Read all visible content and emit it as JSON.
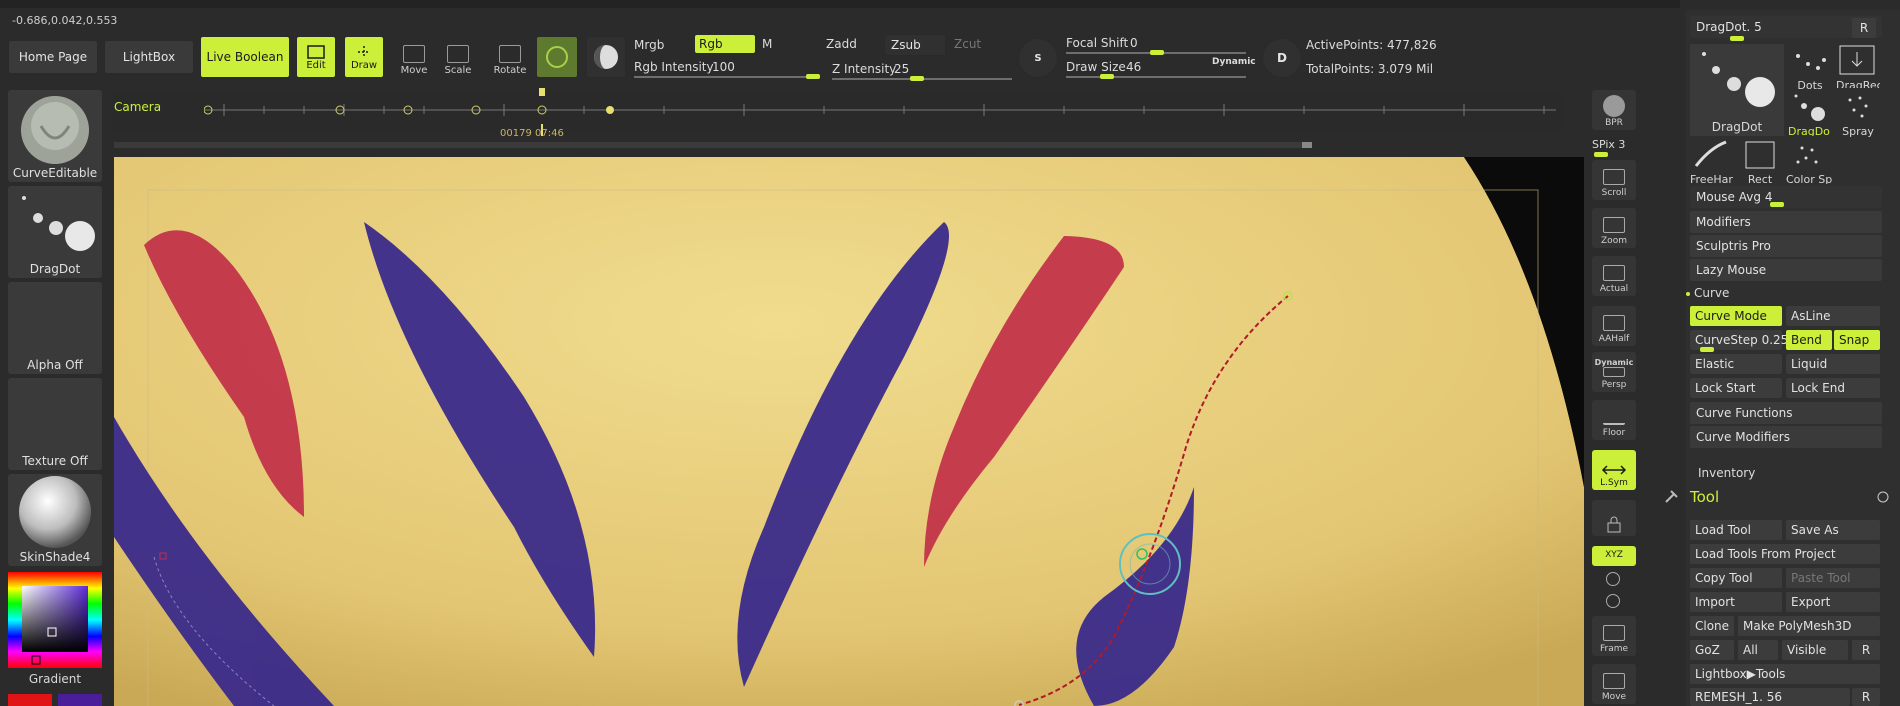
{
  "coords": "-0.686,0.042,0.553",
  "top": {
    "home_page": "Home Page",
    "lightbox": "LightBox",
    "live_boolean": "Live Boolean",
    "edit": "Edit",
    "draw": "Draw",
    "move": "Move",
    "scale": "Scale",
    "rotate": "Rotate",
    "mrgb": "Mrgb",
    "rgb": "Rgb",
    "m": "M",
    "rgb_intensity_label": "Rgb Intensity",
    "rgb_intensity_value": "100",
    "zadd": "Zadd",
    "zsub": "Zsub",
    "zcut": "Zcut",
    "z_intensity_label": "Z Intensity",
    "z_intensity_value": "25",
    "focal_shift_label": "Focal Shift",
    "focal_shift_value": "0",
    "draw_size_label": "Draw Size",
    "draw_size_value": "46",
    "dynamic": "Dynamic",
    "active_points": "ActivePoints: 477,826",
    "total_points": "TotalPoints: 3.079 Mil",
    "s_key": "S",
    "d_key": "D"
  },
  "timeline": {
    "camera": "Camera",
    "time": "00179 07:46"
  },
  "left": {
    "tiles": [
      "CurveEditable",
      "DragDot",
      "Alpha Off",
      "Texture Off",
      "SkinShade4"
    ],
    "gradient": "Gradient"
  },
  "right_tools": [
    "BPR",
    "SPix 3",
    "Scroll",
    "Zoom",
    "Actual",
    "AAHalf",
    "Persp",
    "Floor",
    "L.Sym",
    "XYZ",
    "Frame",
    "Move"
  ],
  "right_tools_extra": {
    "dynamic": "Dynamic"
  },
  "panel": {
    "dragdot_label": "DragDot.",
    "dragdot_value": "5",
    "r": "R",
    "brushes": [
      "DragDot",
      "Dots",
      "DragRec",
      "DragDo",
      "Spray",
      "FreeHar",
      "Rect",
      "Color Sp"
    ],
    "mouse_avg_label": "Mouse Avg",
    "mouse_avg_value": "4",
    "modifiers": "Modifiers",
    "sculptris": "Sculptris Pro",
    "lazy_mouse": "Lazy Mouse",
    "curve": "Curve",
    "curve_mode": "Curve Mode",
    "asline": "AsLine",
    "curvestep_label": "CurveStep",
    "curvestep_value": "0.25",
    "bend": "Bend",
    "snap": "Snap",
    "elastic": "Elastic",
    "liquid": "Liquid",
    "lock_start": "Lock Start",
    "lock_end": "Lock End",
    "curve_functions": "Curve Functions",
    "curve_modifiers": "Curve Modifiers",
    "inventory": "Inventory",
    "tool": "Tool",
    "load_tool": "Load Tool",
    "save_as": "Save As",
    "load_tools_project": "Load Tools From Project",
    "copy_tool": "Copy Tool",
    "paste_tool": "Paste Tool",
    "import": "Import",
    "export": "Export",
    "clone": "Clone",
    "make_polymesh": "Make PolyMesh3D",
    "goz": "GoZ",
    "all": "All",
    "visible": "Visible",
    "lightbox_tools": "Lightbox▶Tools",
    "remesh_label": "REMESH_1.",
    "remesh_value": "56"
  },
  "colors": {
    "accent": "#ccf03a",
    "skin": "#e6cc7a",
    "red_stroke": "#c8324a",
    "blue_stroke": "#3a2a8a"
  }
}
